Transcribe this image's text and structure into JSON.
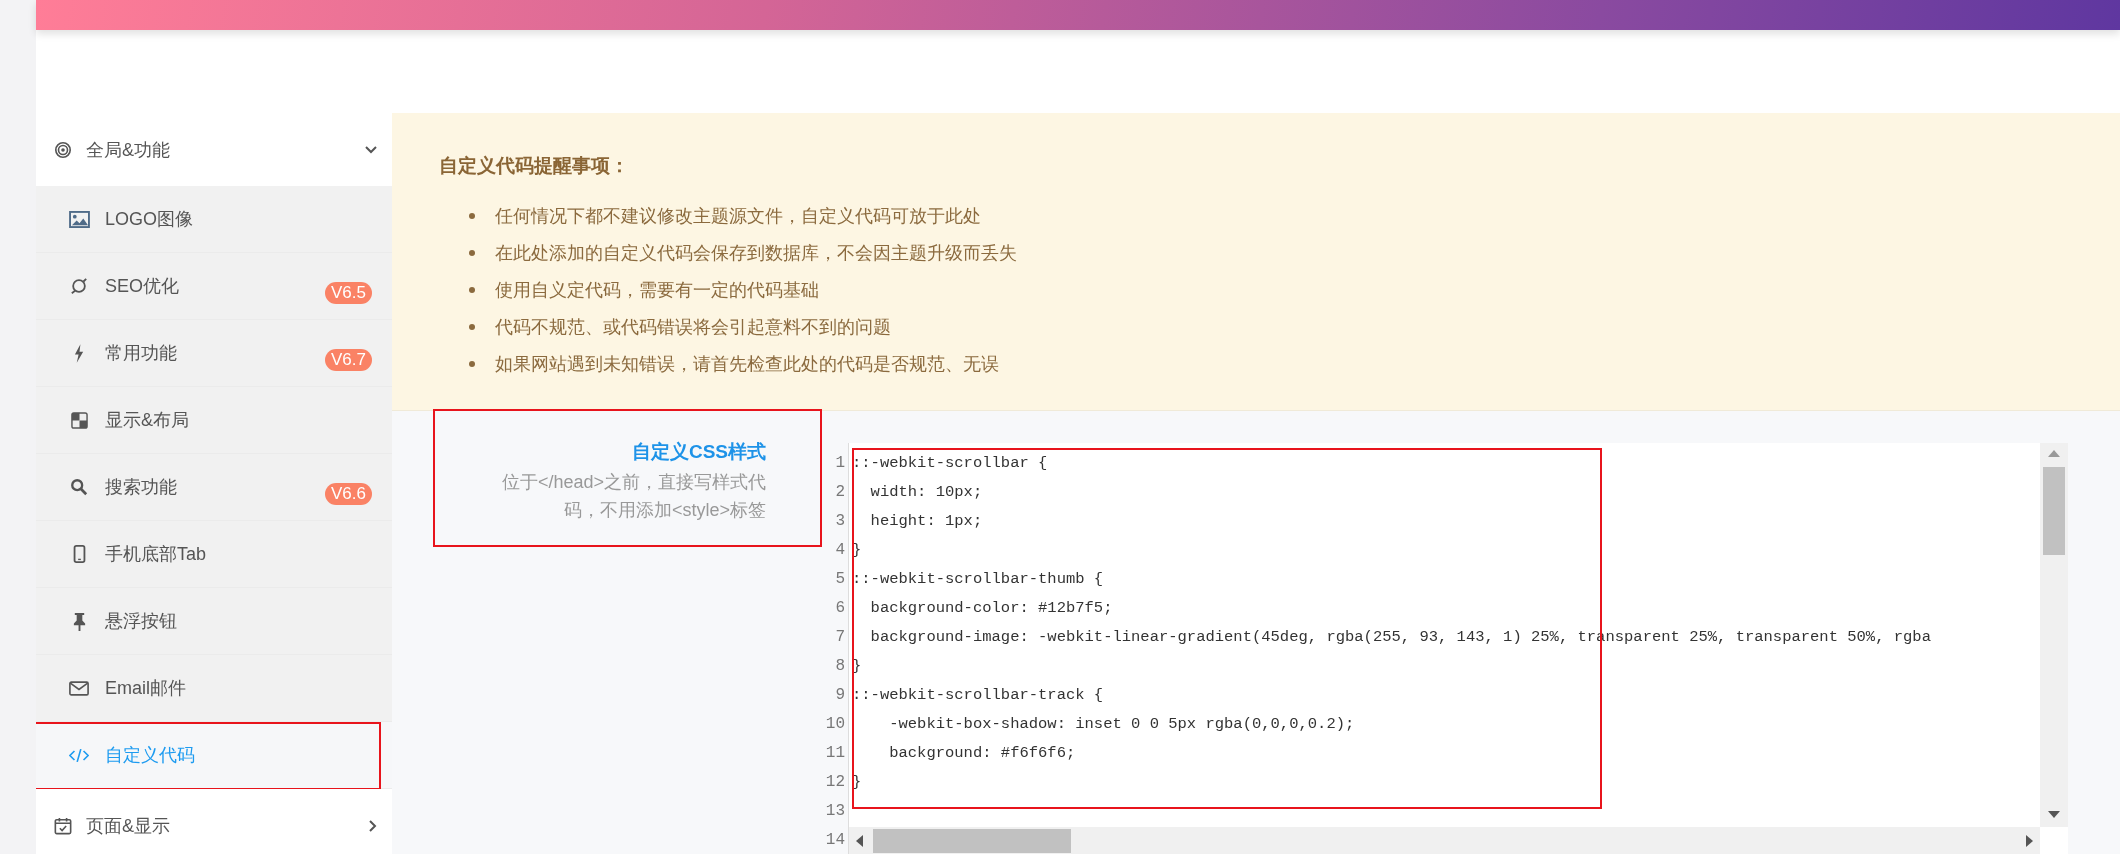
{
  "sidebar": {
    "groups": [
      {
        "label": "全局&功能",
        "expanded": true,
        "children": [
          {
            "label": "LOGO图像",
            "selected": false,
            "highlighted": false
          },
          {
            "label": "SEO优化",
            "badge": "V6.5",
            "selected": false,
            "highlighted": false
          },
          {
            "label": "常用功能",
            "badge": "V6.7",
            "selected": false,
            "highlighted": false
          },
          {
            "label": "显示&布局",
            "selected": false,
            "highlighted": false
          },
          {
            "label": "搜索功能",
            "badge": "V6.6",
            "selected": false,
            "highlighted": false
          },
          {
            "label": "手机底部Tab",
            "selected": false,
            "highlighted": false
          },
          {
            "label": "悬浮按钮",
            "selected": false,
            "highlighted": false
          },
          {
            "label": "Email邮件",
            "selected": false,
            "highlighted": false
          },
          {
            "label": "自定义代码",
            "selected": true,
            "highlighted": true
          }
        ]
      },
      {
        "label": "页面&显示",
        "expanded": false
      }
    ]
  },
  "notice": {
    "title": "自定义代码提醒事项：",
    "items": [
      "任何情况下都不建议修改主题源文件，自定义代码可放于此处",
      "在此处添加的自定义代码会保存到数据库，不会因主题升级而丢失",
      "使用自义定代码，需要有一定的代码基础",
      "代码不规范、或代码错误将会引起意料不到的问题",
      "如果网站遇到未知错误，请首先检查此处的代码是否规范、无误"
    ]
  },
  "setting": {
    "title": "自定义CSS样式",
    "description": "位于</head>之前，直接写样式代码，不用添加<style>标签",
    "highlighted": true,
    "editor": {
      "highlighted": true,
      "lines": [
        {
          "number": "1",
          "code": "::-webkit-scrollbar {"
        },
        {
          "number": "2",
          "code": "  width: 10px;"
        },
        {
          "number": "3",
          "code": "  height: 1px;"
        },
        {
          "number": "4",
          "code": "}"
        },
        {
          "number": "5",
          "code": "::-webkit-scrollbar-thumb {"
        },
        {
          "number": "6",
          "code": "  background-color: #12b7f5;"
        },
        {
          "number": "7",
          "code": "  background-image: -webkit-linear-gradient(45deg, rgba(255, 93, 143, 1) 25%, transparent 25%, transparent 50%, rgba"
        },
        {
          "number": "8",
          "code": "}"
        },
        {
          "number": "9",
          "code": "::-webkit-scrollbar-track {"
        },
        {
          "number": "10",
          "code": "    -webkit-box-shadow: inset 0 0 5px rgba(0,0,0,0.2);"
        },
        {
          "number": "11",
          "code": "    background: #f6f6f6;"
        },
        {
          "number": "12",
          "code": "}"
        },
        {
          "number": "13"
        },
        {
          "number": "14"
        }
      ]
    }
  }
}
